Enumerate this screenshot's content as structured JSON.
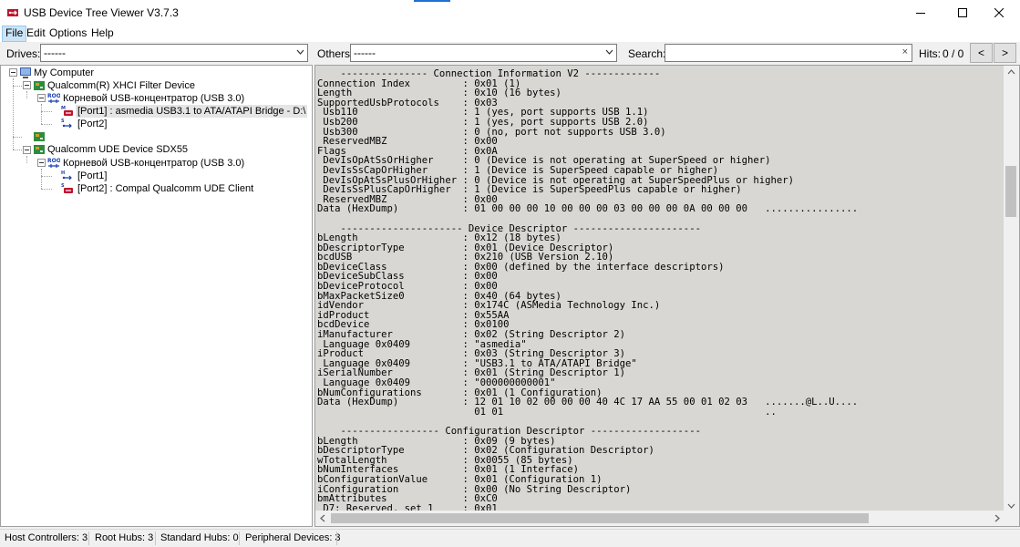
{
  "window": {
    "title": "USB Device Tree Viewer V3.7.3",
    "accent_color": "#1f6fd6"
  },
  "menu": {
    "items": [
      {
        "label": "File"
      },
      {
        "label": "Edit"
      },
      {
        "label": "Options"
      },
      {
        "label": "Help"
      }
    ]
  },
  "toolbar": {
    "drives_label": "Drives:",
    "drives_value": "------",
    "others_label": "Others:",
    "others_value": "------",
    "search_label": "Search:",
    "search_value": "",
    "search_clear": "×",
    "hits_label": "Hits:",
    "hits_value": "0 / 0",
    "prev_label": "<",
    "next_label": ">"
  },
  "tree": {
    "nodes": [
      {
        "label": "My Computer",
        "icon": "computer-icon"
      },
      {
        "label": "Qualcomm(R) XHCI Filter Device",
        "icon": "host-controller-icon"
      },
      {
        "label": "Корневой USB-концентратор (USB 3.0)",
        "icon": "root-hub-icon",
        "icon_text": "ROOT"
      },
      {
        "label": "[Port1] : asmedia USB3.1 to ATA/ATAPI Bridge - D:\\",
        "icon": "usb-storage-port-icon",
        "icon_text": "MS"
      },
      {
        "label": "[Port2]",
        "icon": "usb-port-icon",
        "icon_text": "SS"
      },
      {
        "label": "",
        "icon": "host-controller-icon"
      },
      {
        "label": "Qualcomm UDE Device SDX55",
        "icon": "host-controller-icon"
      },
      {
        "label": "Корневой USB-концентратор (USB 3.0)",
        "icon": "root-hub-icon",
        "icon_text": "ROOT"
      },
      {
        "label": "[Port1]",
        "icon": "usb-port-icon",
        "icon_text": "HS"
      },
      {
        "label": "[Port2] : Compal Qualcomm UDE Client",
        "icon": "usb-device-port-icon",
        "icon_text": "SS"
      }
    ]
  },
  "details": {
    "lines": [
      "    --------------- Connection Information V2 -------------",
      "Connection Index         : 0x01 (1)",
      "Length                   : 0x10 (16 bytes)",
      "SupportedUsbProtocols    : 0x03",
      " Usb110                  : 1 (yes, port supports USB 1.1)",
      " Usb200                  : 1 (yes, port supports USB 2.0)",
      " Usb300                  : 0 (no, port not supports USB 3.0)",
      " ReservedMBZ             : 0x00",
      "Flags                    : 0x0A",
      " DevIsOpAtSsOrHigher     : 0 (Device is not operating at SuperSpeed or higher)",
      " DevIsSsCapOrHigher      : 1 (Device is SuperSpeed capable or higher)",
      " DevIsOpAtSsPlusOrHigher : 0 (Device is not operating at SuperSpeedPlus or higher)",
      " DevIsSsPlusCapOrHigher  : 1 (Device is SuperSpeedPlus capable or higher)",
      " ReservedMBZ             : 0x00",
      "Data (HexDump)           : 01 00 00 00 10 00 00 00 03 00 00 00 0A 00 00 00   ................",
      "",
      "    --------------------- Device Descriptor ----------------------",
      "bLength                  : 0x12 (18 bytes)",
      "bDescriptorType          : 0x01 (Device Descriptor)",
      "bcdUSB                   : 0x210 (USB Version 2.10)",
      "bDeviceClass             : 0x00 (defined by the interface descriptors)",
      "bDeviceSubClass          : 0x00",
      "bDeviceProtocol          : 0x00",
      "bMaxPacketSize0          : 0x40 (64 bytes)",
      "idVendor                 : 0x174C (ASMedia Technology Inc.)",
      "idProduct                : 0x55AA",
      "bcdDevice                : 0x0100",
      "iManufacturer            : 0x02 (String Descriptor 2)",
      " Language 0x0409         : \"asmedia\"",
      "iProduct                 : 0x03 (String Descriptor 3)",
      " Language 0x0409         : \"USB3.1 to ATA/ATAPI Bridge\"",
      "iSerialNumber            : 0x01 (String Descriptor 1)",
      " Language 0x0409         : \"000000000001\"",
      "bNumConfigurations       : 0x01 (1 Configuration)",
      "Data (HexDump)           : 12 01 10 02 00 00 00 40 4C 17 AA 55 00 01 02 03   .......@L..U....",
      "                           01 01                                             ..",
      "",
      "    ----------------- Configuration Descriptor -------------------",
      "bLength                  : 0x09 (9 bytes)",
      "bDescriptorType          : 0x02 (Configuration Descriptor)",
      "wTotalLength             : 0x0055 (85 bytes)",
      "bNumInterfaces           : 0x01 (1 Interface)",
      "bConfigurationValue      : 0x01 (Configuration 1)",
      "iConfiguration           : 0x00 (No String Descriptor)",
      "bmAttributes             : 0xC0",
      " D7: Reserved, set 1     : 0x01"
    ]
  },
  "status": {
    "host_controllers": "Host Controllers: 3",
    "root_hubs": "Root Hubs: 3",
    "standard_hubs": "Standard Hubs: 0",
    "peripheral_devices": "Peripheral Devices: 3"
  }
}
